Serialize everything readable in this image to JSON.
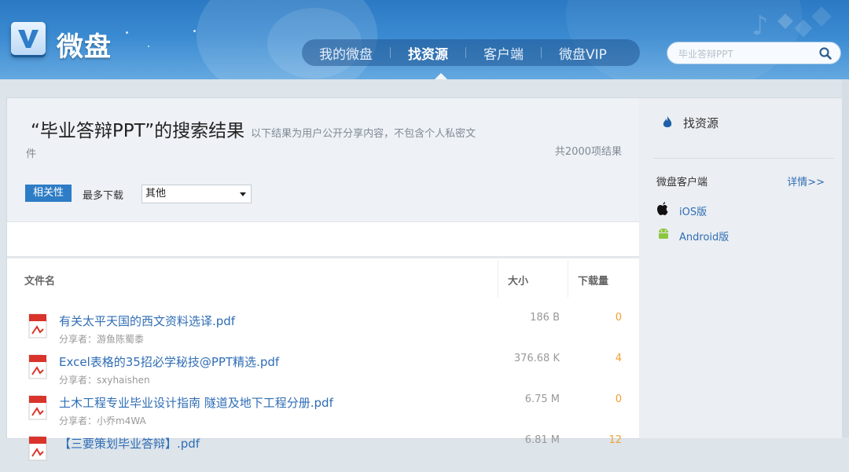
{
  "header": {
    "logo_text": "微盘",
    "nav": [
      {
        "label": "我的微盘",
        "active": false
      },
      {
        "label": "找资源",
        "active": true
      },
      {
        "label": "客户端",
        "active": false
      },
      {
        "label": "微盘VIP",
        "active": false
      }
    ],
    "search_placeholder": "毕业答辩PPT"
  },
  "results": {
    "title": "“毕业答辩PPT”的搜索结果",
    "note": "以下结果为用户公开分享内容，不包含个人私密文",
    "note_wrap": "件",
    "count": "共2000项结果",
    "sort_relevance": "相关性",
    "sort_downloads": "最多下载",
    "filter_value": "其他",
    "columns": {
      "name": "文件名",
      "size": "大小",
      "downloads": "下载量"
    },
    "rows": [
      {
        "name": "有关太平天国的西文资料选译.pdf",
        "sharer": "分享者：游鱼陈蜀黍",
        "size": "186 B",
        "downloads": "0"
      },
      {
        "name": "Excel表格的35招必学秘技@PPT精选.pdf",
        "sharer": "分享者：sxyhaishen",
        "size": "376.68 K",
        "downloads": "4"
      },
      {
        "name": "土木工程专业毕业设计指南 隧道及地下工程分册.pdf",
        "sharer": "分享者：小乔m4WA",
        "size": "6.75 M",
        "downloads": "0"
      },
      {
        "name": "【三要策划毕业答辩】.pdf",
        "sharer": "",
        "size": "6.81 M",
        "downloads": "12"
      }
    ]
  },
  "sidebar": {
    "title": "找资源",
    "client_label": "微盘客户端",
    "more_label": "详情>>",
    "ios_label": "iOS版",
    "android_label": "Android版"
  },
  "colors": {
    "accent": "#2d7cc6",
    "link": "#2f6db5",
    "download_count": "#f0a030"
  }
}
